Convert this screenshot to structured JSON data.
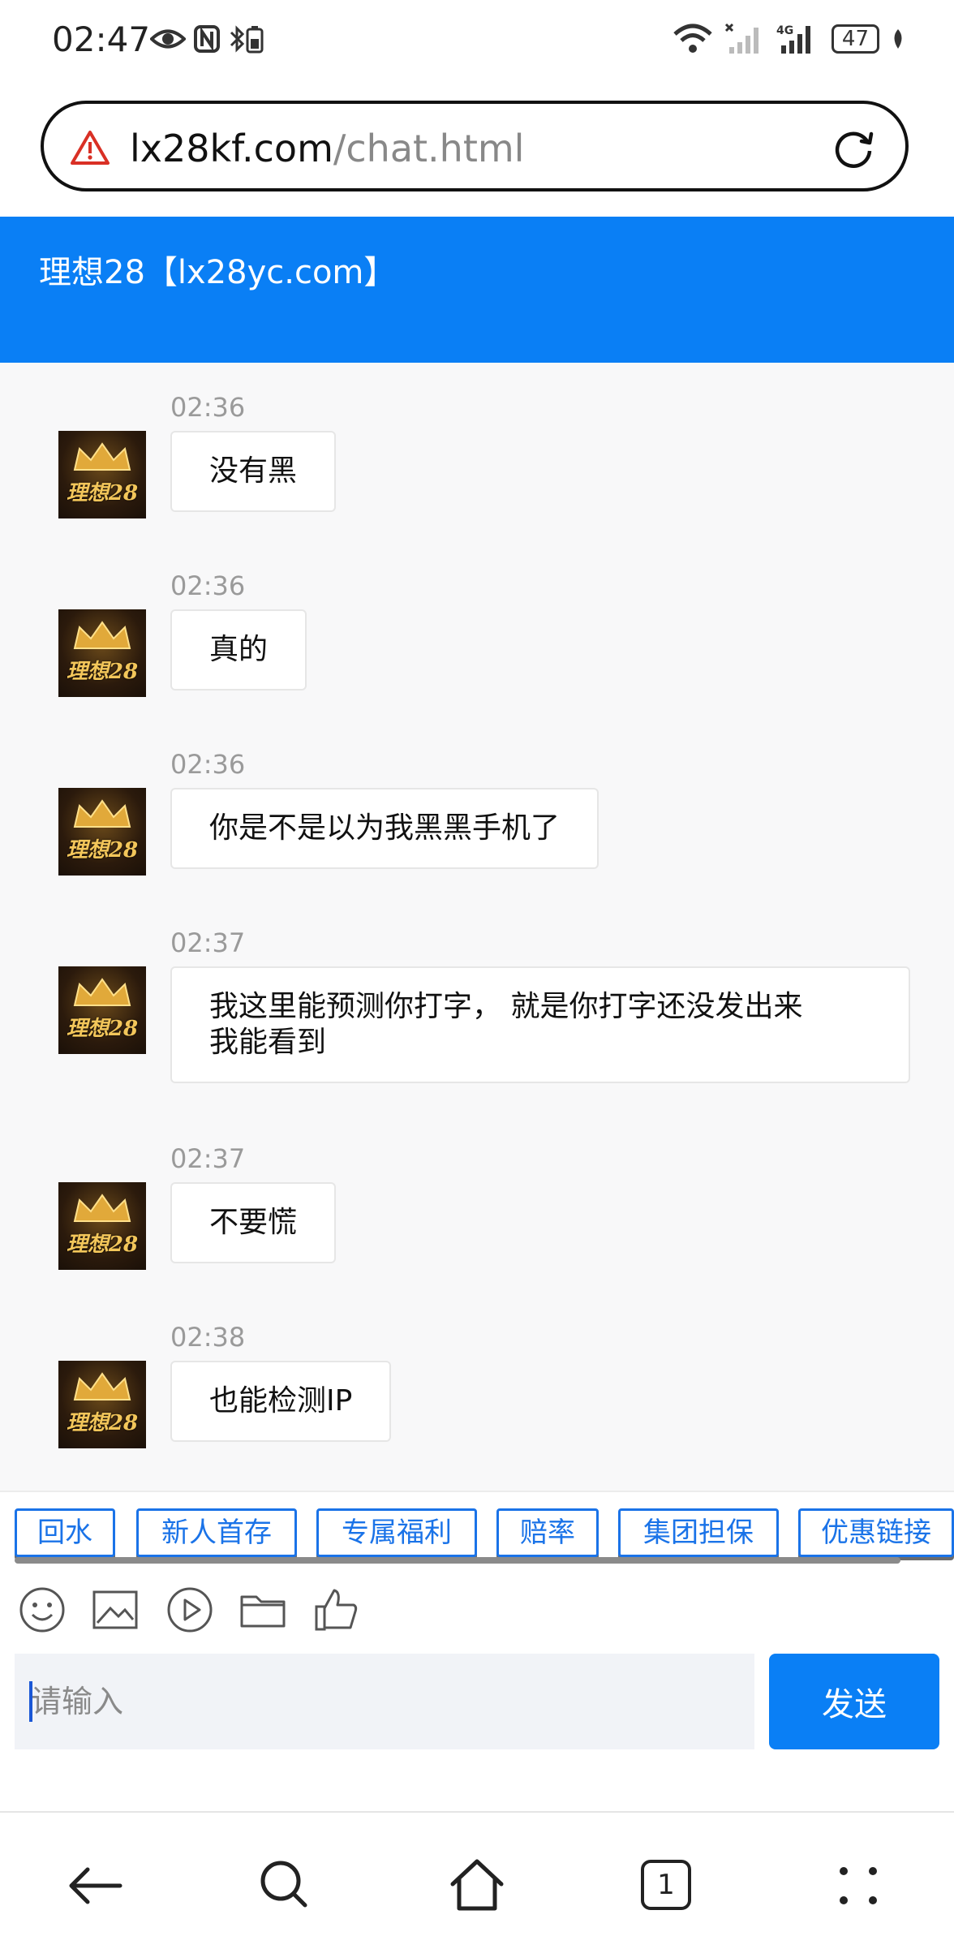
{
  "status_bar": {
    "time": "02:47",
    "battery": "47"
  },
  "browser": {
    "url_host": "lx28kf.com",
    "url_path": "/chat.html"
  },
  "chat": {
    "title": "理想28【lx28yc.com】",
    "avatar_label": "理想28",
    "messages": [
      {
        "time": "02:36",
        "text": "没有黑"
      },
      {
        "time": "02:36",
        "text": "真的"
      },
      {
        "time": "02:36",
        "text": "你是不是以为我黑黑手机了"
      },
      {
        "time": "02:37",
        "text_line1": "我这里能预测你打字， 就是你打字还没发出来",
        "text_line2": "我能看到"
      },
      {
        "time": "02:37",
        "text": "不要慌"
      },
      {
        "time": "02:38",
        "text": "也能检测IP"
      }
    ]
  },
  "quick_tags": [
    "回水",
    "新人首存",
    "专属福利",
    "赔率",
    "集团担保",
    "优惠链接"
  ],
  "toolbar": {
    "icons": [
      "emoji-icon",
      "image-icon",
      "video-icon",
      "folder-icon",
      "thumbs-up-icon"
    ]
  },
  "composer": {
    "placeholder": "请输入",
    "send_label": "发送"
  },
  "nav": {
    "tab_count": "1"
  },
  "colors": {
    "accent": "#0a7ff5",
    "tag_blue": "#1a73e8",
    "warning": "#d93025"
  }
}
